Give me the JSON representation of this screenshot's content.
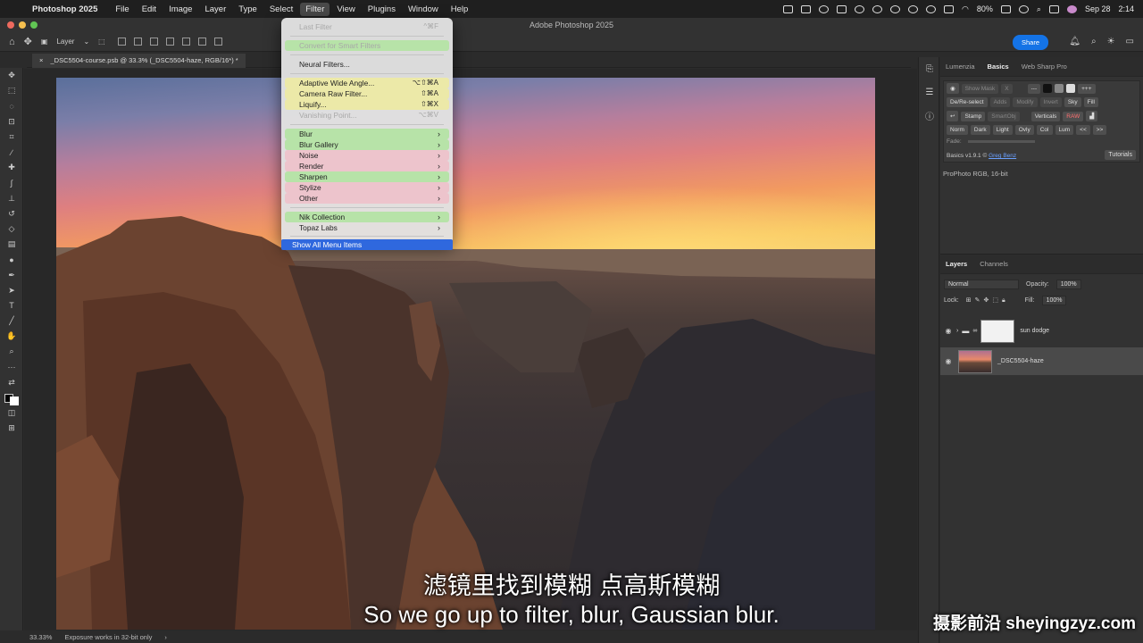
{
  "menubar": {
    "app": "Photoshop 2025",
    "items": [
      "File",
      "Edit",
      "Image",
      "Layer",
      "Type",
      "Select",
      "Filter",
      "View",
      "Plugins",
      "Window",
      "Help"
    ],
    "active": "Filter",
    "battery": "80%",
    "date": "Sep 28",
    "time": "2:14"
  },
  "window_title": "Adobe Photoshop 2025",
  "options_bar": {
    "layer_select": "Layer",
    "share_label": "Share"
  },
  "document_tab": "_DSC5504-course.psb @ 33.3% (_DSC5504-haze, RGB/16*) *",
  "filter_menu": {
    "last_filter": "Last Filter",
    "last_filter_sc": "^⌘F",
    "convert_smart": "Convert for Smart Filters",
    "neural": "Neural Filters...",
    "adaptive": "Adaptive Wide Angle...",
    "adaptive_sc": "⌥⇧⌘A",
    "camera_raw": "Camera Raw Filter...",
    "camera_raw_sc": "⇧⌘A",
    "liquify": "Liquify...",
    "liquify_sc": "⇧⌘X",
    "vanishing": "Vanishing Point...",
    "vanishing_sc": "⌥⌘V",
    "blur": "Blur",
    "blur_gallery": "Blur Gallery",
    "noise": "Noise",
    "render": "Render",
    "sharpen": "Sharpen",
    "stylize": "Stylize",
    "other": "Other",
    "nik": "Nik Collection",
    "topaz": "Topaz Labs",
    "show_all": "Show All Menu Items"
  },
  "right_panel": {
    "tabs": [
      "Lumenzia",
      "Basics",
      "Web Sharp Pro"
    ],
    "active_tab": "Basics",
    "row1": [
      "Show Mask",
      "X",
      "---",
      "+++"
    ],
    "row2": [
      "De/Re-select",
      "Adds",
      "Modify",
      "Invert",
      "Sky",
      "Fill"
    ],
    "row3": [
      "Stamp",
      "SmartObj",
      "Verticals",
      "RAW"
    ],
    "row4": [
      "Norm",
      "Dark",
      "Light",
      "Ovly",
      "Col",
      "Lum",
      "<<",
      ">>"
    ],
    "fade_label": "Fade:",
    "version_text": "Basics v1.9.1 ©",
    "author": "Greg Benz",
    "tutorials": "Tutorials",
    "profile": "ProPhoto RGB, 16-bit"
  },
  "layers_panel": {
    "tabs": [
      "Layers",
      "Channels"
    ],
    "blend_mode": "Normal",
    "opacity_label": "Opacity:",
    "opacity": "100%",
    "lock_label": "Lock:",
    "fill_label": "Fill:",
    "fill": "100%",
    "layers": [
      {
        "name": "sun dodge",
        "selected": false
      },
      {
        "name": "_DSC5504-haze",
        "selected": true
      }
    ]
  },
  "status": {
    "zoom": "33.33%",
    "message": "Exposure works in 32-bit only"
  },
  "subtitles": {
    "cn": "滤镜里找到模糊 点高斯模糊",
    "en": "So we go up to filter, blur, Gaussian blur."
  },
  "watermark": "摄影前沿 sheyingzyz.com",
  "colors": {
    "highlight": "#2f68de",
    "share": "#1473e6",
    "menu_green": "#b7e3a8",
    "menu_yellow": "#ece9a8",
    "menu_pink": "#edc4cc"
  }
}
